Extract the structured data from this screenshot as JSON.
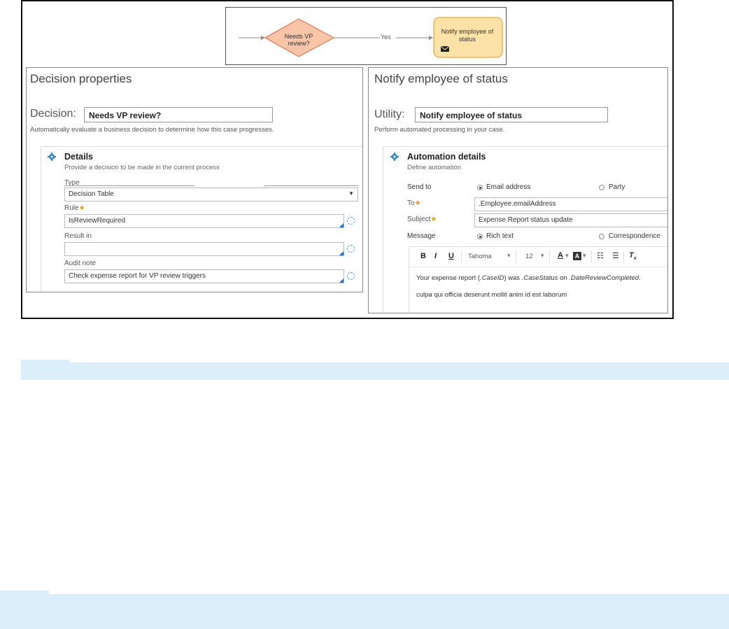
{
  "flow": {
    "decision_label": "Needs VP review?",
    "connector_label": "Yes",
    "step_label": "Notify employee of status"
  },
  "decision_panel": {
    "title": "Decision properties",
    "field_label": "Decision:",
    "field_value": "Needs VP review?",
    "description": "Automatically evaluate a business decision to determine how this case progresses.",
    "details": {
      "title": "Details",
      "subtitle": "Provide a decision to be made in the current process",
      "type_label": "Type",
      "type_value": "Decision Table",
      "rule_label": "Rule",
      "rule_value": "IsReviewRequired",
      "result_label": "Result in",
      "result_value": "",
      "audit_label": "Audit note",
      "audit_value": "Check expense report for VP review triggers"
    }
  },
  "utility_panel": {
    "title": "Notify employee of status",
    "field_label": "Utility:",
    "field_value": "Notify employee of status",
    "description": "Perform automated processing in your case.",
    "automation": {
      "title": "Automation details",
      "subtitle": "Define automation",
      "send_to_label": "Send to",
      "send_to_options": [
        "Email address",
        "Party"
      ],
      "to_label": "To",
      "to_value": ".Employee.emailAddress",
      "subject_label": "Subject",
      "subject_value": "Expense Report status update",
      "message_label": "Message",
      "message_options": [
        "Rich text",
        "Correspondence"
      ],
      "toolbar": {
        "bold": "B",
        "italic": "I",
        "underline": "U",
        "font": "Tahoma",
        "size": "12",
        "text_color": "A",
        "bg_color": "A"
      },
      "editor_line1_a": "Your expense report (",
      "editor_line1_b": ".CaseID",
      "editor_line1_c": ") was ",
      "editor_line1_d": ".CaseStatus",
      "editor_line1_e": " on ",
      "editor_line1_f": ".DateReviewCompleted",
      "editor_line1_g": ".",
      "editor_line2": "culpa qui officia deserunt mollit anim id est laborum"
    }
  },
  "colors": {
    "decision_fill": "#f9c5a8",
    "decision_stroke": "#e8754b",
    "step_fill": "#fde2a8",
    "step_stroke": "#e8a93a",
    "required": "#e59a1a",
    "accent": "#1f6fc7",
    "bar": "#dbeefa"
  }
}
